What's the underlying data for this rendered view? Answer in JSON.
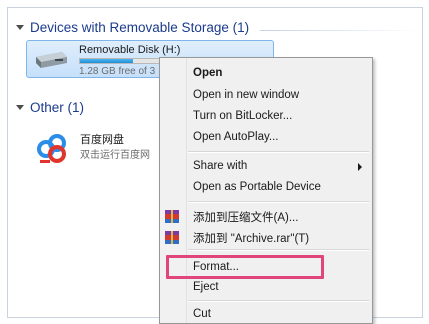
{
  "devices_group": {
    "header": "Devices with Removable Storage (1)"
  },
  "removable_disk": {
    "name": "Removable Disk (H:)",
    "free_text": "1.28 GB free of 3",
    "usage_fraction": 0.55
  },
  "other_group": {
    "header": "Other (1)"
  },
  "other_item": {
    "name": "百度网盘",
    "description": "双击运行百度网"
  },
  "context_menu": {
    "open": "Open",
    "open_new_window": "Open in new window",
    "turn_on_bitlocker": "Turn on BitLocker...",
    "open_autoplay": "Open AutoPlay...",
    "share_with": "Share with",
    "open_portable": "Open as Portable Device",
    "add_to_archive": "添加到压缩文件(A)...",
    "add_to_archive_rar": "添加到 \"Archive.rar\"(T)",
    "format": "Format...",
    "eject": "Eject",
    "cut": "Cut"
  },
  "colors": {
    "highlight_box": "#e0457b",
    "selection_bg": "#c6e0fb",
    "group_header": "#1b3b8c"
  }
}
